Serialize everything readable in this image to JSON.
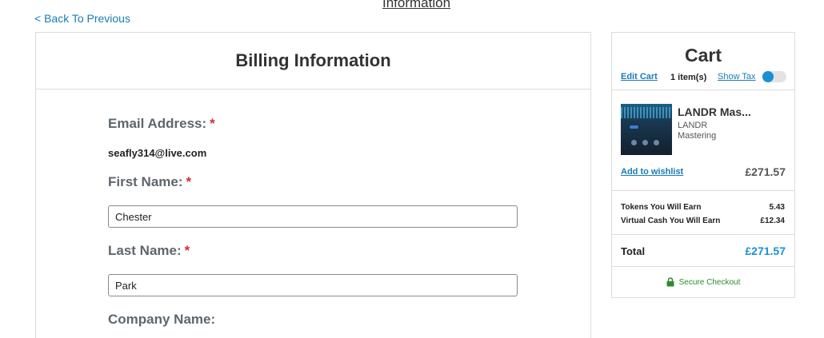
{
  "page": {
    "top_link": "Information",
    "back_link": "< Back To Previous"
  },
  "billing": {
    "title": "Billing Information",
    "required_marker": "*",
    "email": {
      "label": "Email Address:",
      "value": "seafly314@live.com"
    },
    "first_name": {
      "label": "First Name:",
      "value": "Chester"
    },
    "last_name": {
      "label": "Last Name:",
      "value": "Park"
    },
    "company": {
      "label": "Company Name:"
    }
  },
  "cart": {
    "title": "Cart",
    "edit_label": "Edit Cart",
    "item_count": "1 item(s)",
    "show_tax_label": "Show Tax",
    "show_tax_on": false,
    "item": {
      "name": "LANDR Mas...",
      "subtitle": "LANDR Mastering",
      "wishlist_label": "Add to wishlist",
      "price": "£271.57",
      "icon": "product-thumbnail"
    },
    "tokens": {
      "label": "Tokens You Will Earn",
      "value": "5.43"
    },
    "virtual_cash": {
      "label": "Virtual Cash You Will Earn",
      "value": "£12.34"
    },
    "total": {
      "label": "Total",
      "value": "£271.57"
    },
    "secure_checkout": {
      "label": "Secure Checkout",
      "icon": "lock-icon"
    }
  },
  "colors": {
    "link": "#1a7cb5",
    "accent": "#1a8fd6",
    "required": "#d0312d",
    "secure": "#2e8b2e"
  }
}
